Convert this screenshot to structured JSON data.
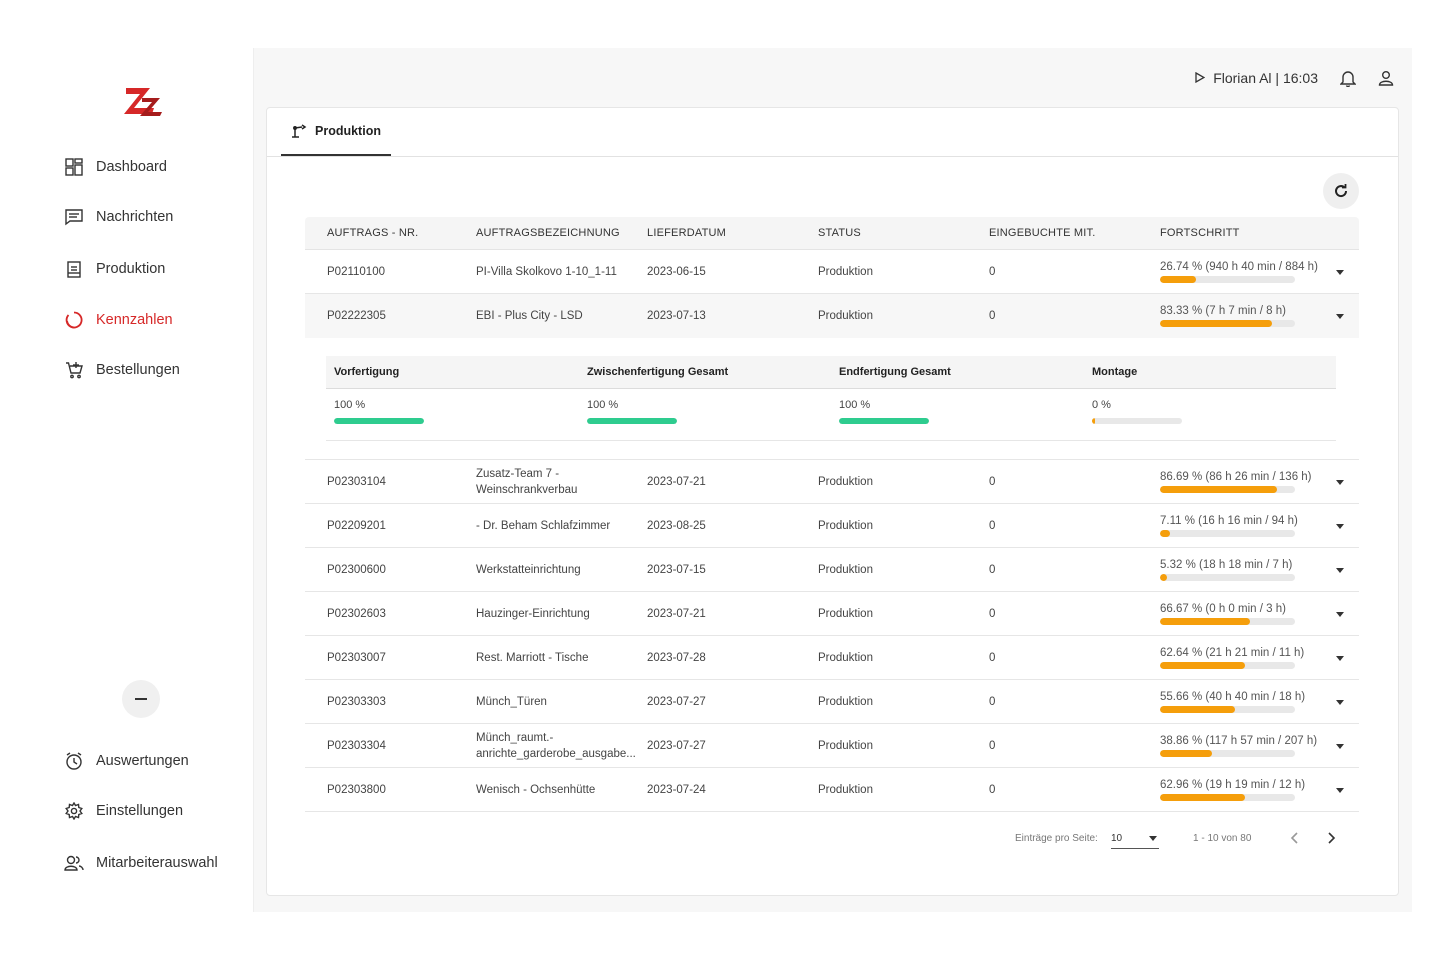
{
  "sidebar": {
    "items": [
      {
        "label": "Dashboard",
        "icon": "dashboard-icon"
      },
      {
        "label": "Nachrichten",
        "icon": "message-icon"
      },
      {
        "label": "Produktion",
        "icon": "clipboard-icon"
      },
      {
        "label": "Kennzahlen",
        "icon": "circle-loader-icon",
        "active": true
      },
      {
        "label": "Bestellungen",
        "icon": "cart-icon"
      }
    ],
    "bottom_items": [
      {
        "label": "Auswertungen",
        "icon": "clock-icon"
      },
      {
        "label": "Einstellungen",
        "icon": "gear-icon"
      },
      {
        "label": "Mitarbeiterauswahl",
        "icon": "users-icon"
      }
    ],
    "accent": "#d62828"
  },
  "header": {
    "user": "Florian Al | 16:03"
  },
  "tab": {
    "label": "Produktion"
  },
  "table": {
    "headers": [
      "AUFTRAGS - NR.",
      "AUFTRAGSBEZEICHNUNG",
      "LIEFERDATUM",
      "STATUS",
      "EINGEBUCHTE MIT.",
      "FORTSCHRITT"
    ],
    "rows": [
      {
        "nr": "P02110100",
        "bez": "PI-Villa Skolkovo 1-10_1-11",
        "date": "2023-06-15",
        "status": "Produktion",
        "mit": "0",
        "progress": "26.74 % (940 h 40 min / 884 h)",
        "pct": 26.74
      },
      {
        "nr": "P02222305",
        "bez": "EBI - Plus City - LSD",
        "date": "2023-07-13",
        "status": "Produktion",
        "mit": "0",
        "progress": "83.33 % (7 h 7 min / 8 h)",
        "pct": 83.33
      },
      {
        "nr": "P02303104",
        "bez": "Zusatz-Team 7 - Weinschrankverbau",
        "date": "2023-07-21",
        "status": "Produktion",
        "mit": "0",
        "progress": "86.69 % (86 h 26 min / 136 h)",
        "pct": 86.69
      },
      {
        "nr": "P02209201",
        "bez": "- Dr. Beham Schlafzimmer",
        "date": "2023-08-25",
        "status": "Produktion",
        "mit": "0",
        "progress": "7.11 % (16 h 16 min / 94 h)",
        "pct": 7.11
      },
      {
        "nr": "P02300600",
        "bez": "Werkstatteinrichtung",
        "date": "2023-07-15",
        "status": "Produktion",
        "mit": "0",
        "progress": "5.32 % (18 h 18 min / 7 h)",
        "pct": 5.32
      },
      {
        "nr": "P02302603",
        "bez": "Hauzinger-Einrichtung",
        "date": "2023-07-21",
        "status": "Produktion",
        "mit": "0",
        "progress": "66.67 % (0 h 0 min / 3 h)",
        "pct": 66.67
      },
      {
        "nr": "P02303007",
        "bez": "Rest. Marriott - Tische",
        "date": "2023-07-28",
        "status": "Produktion",
        "mit": "0",
        "progress": "62.64 % (21 h 21 min / 11 h)",
        "pct": 62.64
      },
      {
        "nr": "P02303303",
        "bez": "Münch_Türen",
        "date": "2023-07-27",
        "status": "Produktion",
        "mit": "0",
        "progress": "55.66 % (40 h 40 min / 18 h)",
        "pct": 55.66
      },
      {
        "nr": "P02303304",
        "bez": "Münch_raumt.-anrichte_garderobe_ausgabe...",
        "date": "2023-07-27",
        "status": "Produktion",
        "mit": "0",
        "progress": "38.86 % (117 h 57 min / 207 h)",
        "pct": 38.86
      },
      {
        "nr": "P02303800",
        "bez": "Wenisch - Ochsenhütte",
        "date": "2023-07-24",
        "status": "Produktion",
        "mit": "0",
        "progress": "62.96 % (19 h 19 min / 12 h)",
        "pct": 62.96
      }
    ],
    "expanded_row": 1,
    "detail": {
      "headers": [
        "Vorfertigung",
        "Zwischenfertigung Gesamt",
        "Endfertigung Gesamt",
        "Montage"
      ],
      "values": [
        "100 %",
        "100 %",
        "100 %",
        "0 %"
      ],
      "pcts": [
        100,
        100,
        100,
        0
      ]
    },
    "progress_color": "#f59e0b",
    "detail_color": "#2ecc8f"
  },
  "pager": {
    "label": "Einträge pro Seite:",
    "per_page": "10",
    "range": "1 - 10 von 80"
  }
}
